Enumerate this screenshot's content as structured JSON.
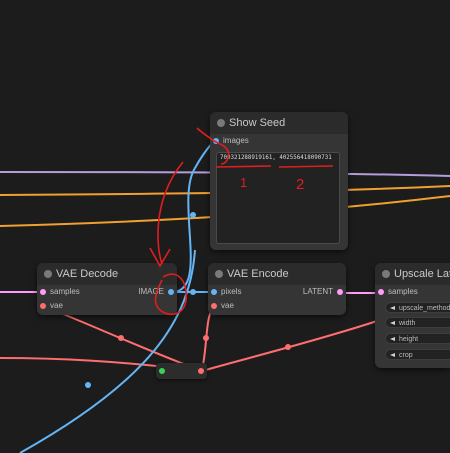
{
  "nodes": {
    "show_seed": {
      "title": "Show Seed",
      "input_label": "images",
      "output_text": "700321288919161, 402556418090731"
    },
    "vae_decode": {
      "title": "VAE Decode",
      "inputs": [
        "samples",
        "vae"
      ],
      "output_label": "IMAGE"
    },
    "vae_encode": {
      "title": "VAE Encode",
      "inputs": [
        "pixels",
        "vae"
      ],
      "output_label": "LATENT"
    },
    "upscale_latent": {
      "title": "Upscale Latent",
      "input_label": "samples",
      "widgets": [
        "upscale_method",
        "width",
        "height",
        "crop"
      ]
    }
  },
  "annotations": [
    "1",
    "2"
  ],
  "colors": {
    "canvas": "#1c1c1c",
    "node_body": "#353535",
    "node_title": "#2b2b2b",
    "image_link": "#64b5f6",
    "vae_link": "#ff6e6e",
    "latent_link": "#ff9cf9",
    "orange_link": "#f0a030",
    "purple_link": "#b39ddb",
    "annotation_red": "#e01e1e"
  }
}
